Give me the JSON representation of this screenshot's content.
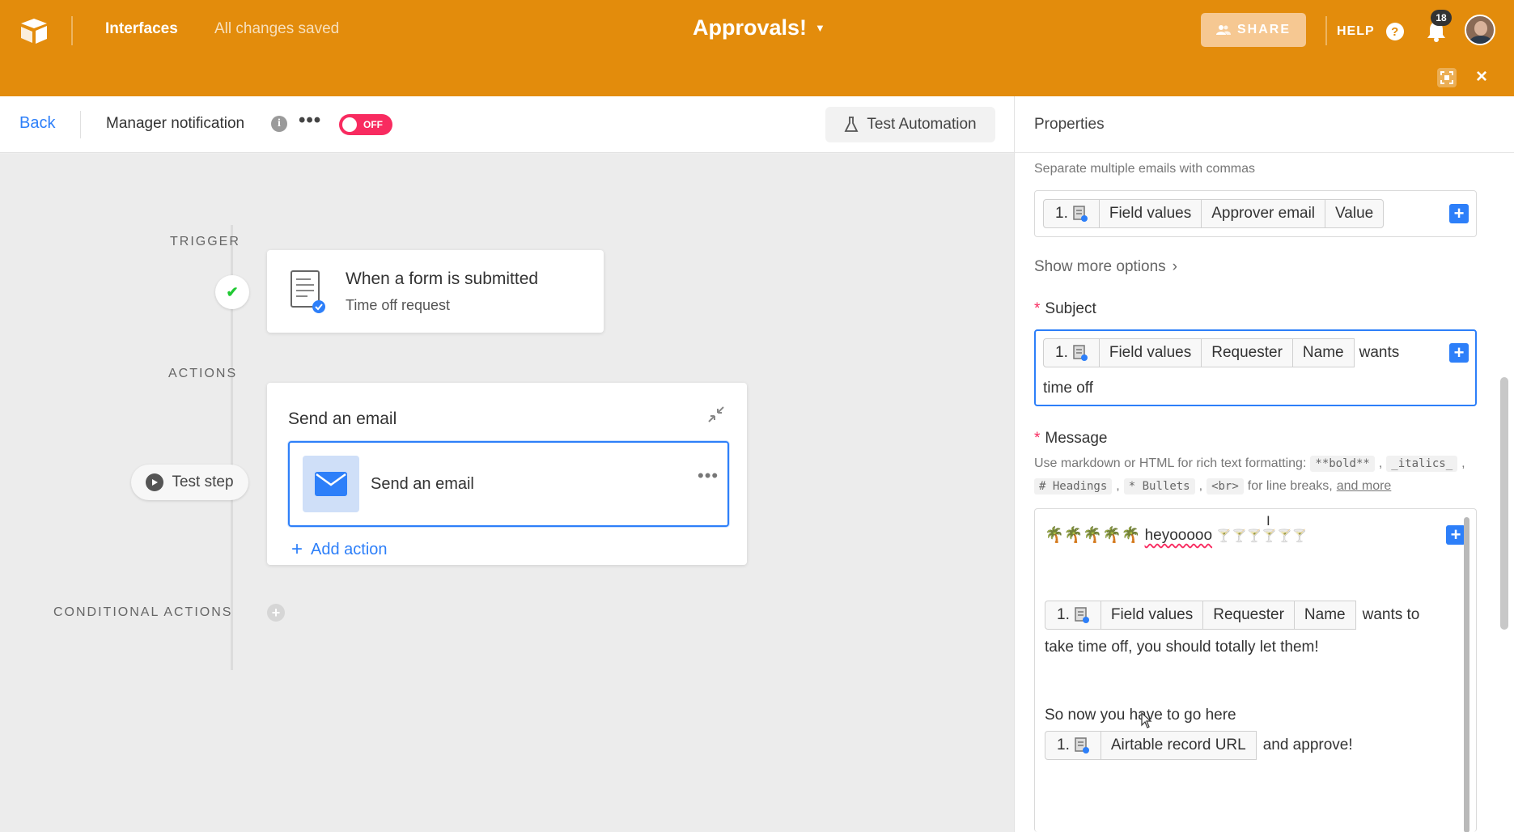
{
  "topbar": {
    "interfaces_label": "Interfaces",
    "save_status": "All changes saved",
    "base_title": "Approvals!",
    "share_label": "SHARE",
    "help_label": "HELP",
    "notification_count": "18",
    "accent_color": "#e38c0c"
  },
  "automation_bar": {
    "back_label": "Back",
    "automation_name": "Manager notification",
    "toggle_label": "OFF",
    "test_automation_label": "Test Automation"
  },
  "canvas": {
    "trigger_section": "TRIGGER",
    "actions_section": "ACTIONS",
    "conditional_section": "CONDITIONAL ACTIONS",
    "trigger_card": {
      "title": "When a form is submitted",
      "subtitle": "Time off request"
    },
    "action_card": {
      "title": "Send an email",
      "step_label": "Send an email",
      "add_action_label": "Add action"
    },
    "test_step_label": "Test step"
  },
  "properties": {
    "title": "Properties",
    "to_help": "Separate multiple emails with commas",
    "to_tokens": [
      "1.",
      "Field values",
      "Approver email",
      "Value"
    ],
    "show_more_label": "Show more options",
    "subject_label": "Subject",
    "subject_tokens": [
      "1.",
      "Field values",
      "Requester",
      "Name"
    ],
    "subject_text_after": "wants",
    "subject_text_line2": "time off",
    "message_label": "Message",
    "message_hint_prefix": "Use markdown or HTML for rich text formatting:",
    "message_hint_codes": [
      "**bold**",
      "_italics_",
      "# Headings",
      "* Bullets",
      "<br>"
    ],
    "message_hint_suffix": "for line breaks,",
    "message_hint_link": "and more",
    "message": {
      "line1_emoji_left": "🌴🌴🌴🌴🌴",
      "line1_word": "heyooooo",
      "line1_emoji_right": "🍸🍸🍸🍸🍸🍸",
      "tokens_1": [
        "1.",
        "Field values",
        "Requester",
        "Name"
      ],
      "text_after_tokens_1": "wants to",
      "line_2": "take time off, you should totally let them!",
      "line_3": "So now you have to go here",
      "tokens_2": [
        "1.",
        "Airtable record URL"
      ],
      "text_after_tokens_2": "and approve!"
    }
  }
}
